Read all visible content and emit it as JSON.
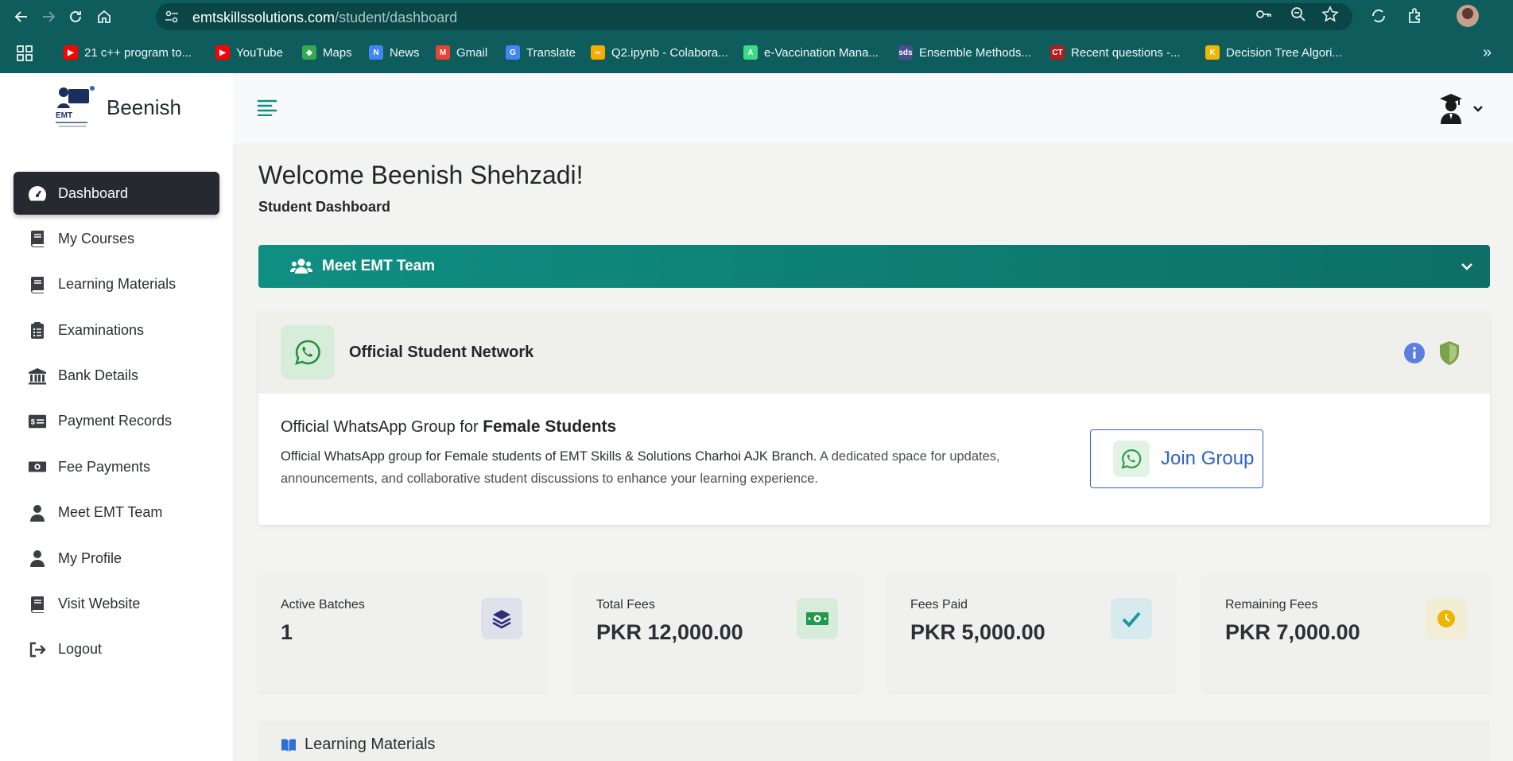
{
  "browser": {
    "url_host": "emtskillssolutions.com",
    "url_path": "/student/dashboard",
    "bookmarks": [
      {
        "label": "21 c++ program to...",
        "icon": "youtube-icon",
        "color": "#ff0000"
      },
      {
        "label": "YouTube",
        "icon": "youtube-icon",
        "color": "#ff0000"
      },
      {
        "label": "Maps",
        "icon": "maps-icon",
        "color": "#34a853"
      },
      {
        "label": "News",
        "icon": "news-icon",
        "color": "#4285f4"
      },
      {
        "label": "Gmail",
        "icon": "gmail-icon",
        "color": "#ea4335"
      },
      {
        "label": "Translate",
        "icon": "translate-icon",
        "color": "#4285f4"
      },
      {
        "label": "Q2.ipynb - Colabora...",
        "icon": "colab-icon",
        "color": "#f9ab00"
      },
      {
        "label": "e-Vaccination Mana...",
        "icon": "android-icon",
        "color": "#3ddc84"
      },
      {
        "label": "Ensemble Methods...",
        "icon": "sds-icon",
        "color": "#4a4e8c"
      },
      {
        "label": "Recent questions -...",
        "icon": "ct-icon",
        "color": "#b01d1d"
      },
      {
        "label": "Decision Tree Algori...",
        "icon": "k-icon",
        "color": "#f2b705"
      }
    ]
  },
  "sidebar": {
    "brand_name": "Beenish",
    "logo_text": "EMT",
    "items": [
      {
        "label": "Dashboard",
        "icon": "speedometer-icon",
        "active": true
      },
      {
        "label": "My Courses",
        "icon": "book-icon"
      },
      {
        "label": "Learning Materials",
        "icon": "book-icon"
      },
      {
        "label": "Examinations",
        "icon": "clipboard-list-icon"
      },
      {
        "label": "Bank Details",
        "icon": "bank-icon"
      },
      {
        "label": "Payment Records",
        "icon": "credit-card-icon"
      },
      {
        "label": "Fee Payments",
        "icon": "money-icon"
      },
      {
        "label": "Meet EMT Team",
        "icon": "user-icon"
      },
      {
        "label": "My Profile",
        "icon": "user-icon"
      },
      {
        "label": "Visit Website",
        "icon": "book-icon"
      },
      {
        "label": "Logout",
        "icon": "logout-icon"
      }
    ]
  },
  "main": {
    "welcome": "Welcome Beenish Shehzadi!",
    "subtitle": "Student Dashboard",
    "team_bar_label": "Meet EMT Team",
    "network": {
      "title": "Official Student Network",
      "group_title_prefix": "Official WhatsApp Group for ",
      "group_title_bold": "Female Students",
      "desc_lead": "Official WhatsApp group for Female students of EMT Skills & Solutions Charhoi AJK Branch.",
      "desc_rest": " A dedicated space for updates, announcements, and collaborative student discussions to enhance your learning experience.",
      "join_label": "Join Group"
    },
    "stats": [
      {
        "label": "Active Batches",
        "value": "1",
        "icon": "layers-icon",
        "icon_bg": "#dfe0ea",
        "icon_color": "#2b2f7a"
      },
      {
        "label": "Total Fees",
        "value": "PKR 12,000.00",
        "icon": "money-bill-icon",
        "icon_bg": "#d8ecdc",
        "icon_color": "#1e9a4a"
      },
      {
        "label": "Fees Paid",
        "value": "PKR 5,000.00",
        "icon": "check-icon",
        "icon_bg": "#d7ebee",
        "icon_color": "#1798a8"
      },
      {
        "label": "Remaining Fees",
        "value": "PKR 7,000.00",
        "icon": "clock-icon",
        "icon_bg": "#f2eed6",
        "icon_color": "#f0b400"
      }
    ],
    "learning_materials_title": "Learning Materials"
  },
  "colors": {
    "chrome": "#0e5c5c",
    "accent_teal": "#0f8f82",
    "sidebar_active": "#262a30",
    "join_blue": "#2f63c7"
  }
}
